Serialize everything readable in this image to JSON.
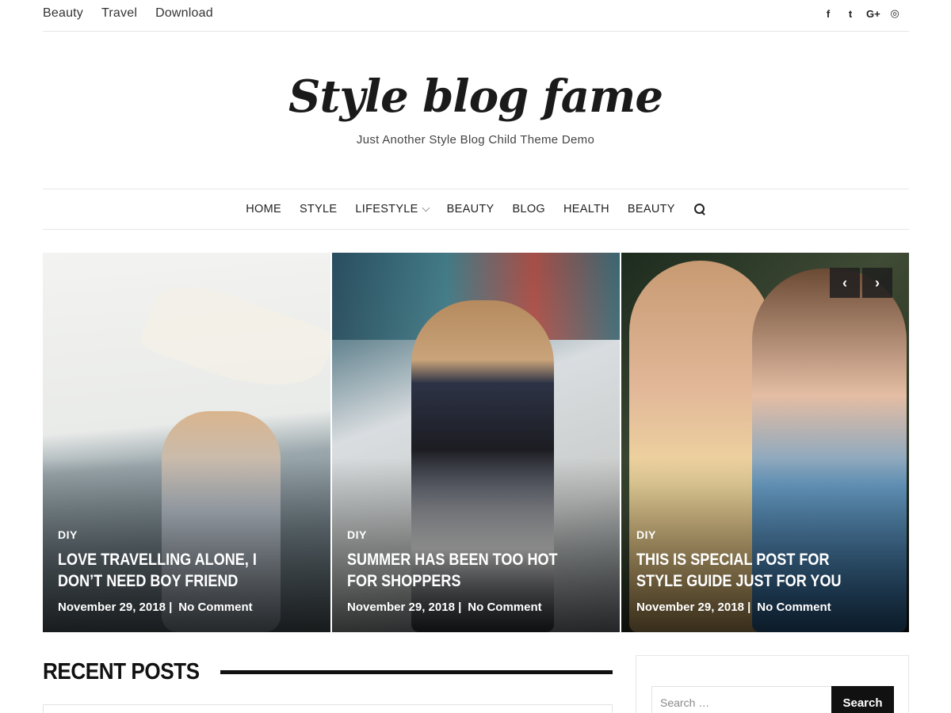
{
  "topbar": {
    "links": [
      "Beauty",
      "Travel",
      "Download"
    ],
    "social": [
      {
        "icon": "facebook-icon",
        "glyph": "f"
      },
      {
        "icon": "twitter-icon",
        "glyph": "t"
      },
      {
        "icon": "google-plus-icon",
        "glyph": "G+"
      },
      {
        "icon": "instagram-icon",
        "glyph": "◎"
      }
    ]
  },
  "branding": {
    "title": "Style blog fame",
    "tagline": "Just Another Style Blog Child Theme Demo"
  },
  "mainnav": {
    "items": [
      "HOME",
      "STYLE",
      "LIFESTYLE",
      "BEAUTY",
      "BLOG",
      "HEALTH",
      "BEAUTY"
    ]
  },
  "slider": {
    "prev_label": "‹",
    "next_label": "›",
    "slides": [
      {
        "category": "DIY",
        "title": "LOVE TRAVELLING ALONE, I DON’T NEED BOY FRIEND",
        "date": "November 29, 2018 |",
        "comments": "No Comment"
      },
      {
        "category": "DIY",
        "title": "SUMMER HAS BEEN TOO HOT FOR SHOPPERS",
        "date": "November 29, 2018 |",
        "comments": "No Comment"
      },
      {
        "category": "DIY",
        "title": "THIS IS SPECIAL POST FOR STYLE GUIDE JUST FOR YOU",
        "date": "November 29, 2018 |",
        "comments": "No Comment"
      }
    ]
  },
  "recent": {
    "heading": "RECENT POSTS"
  },
  "sidebar": {
    "search_placeholder": "Search …",
    "search_button": "Search"
  }
}
